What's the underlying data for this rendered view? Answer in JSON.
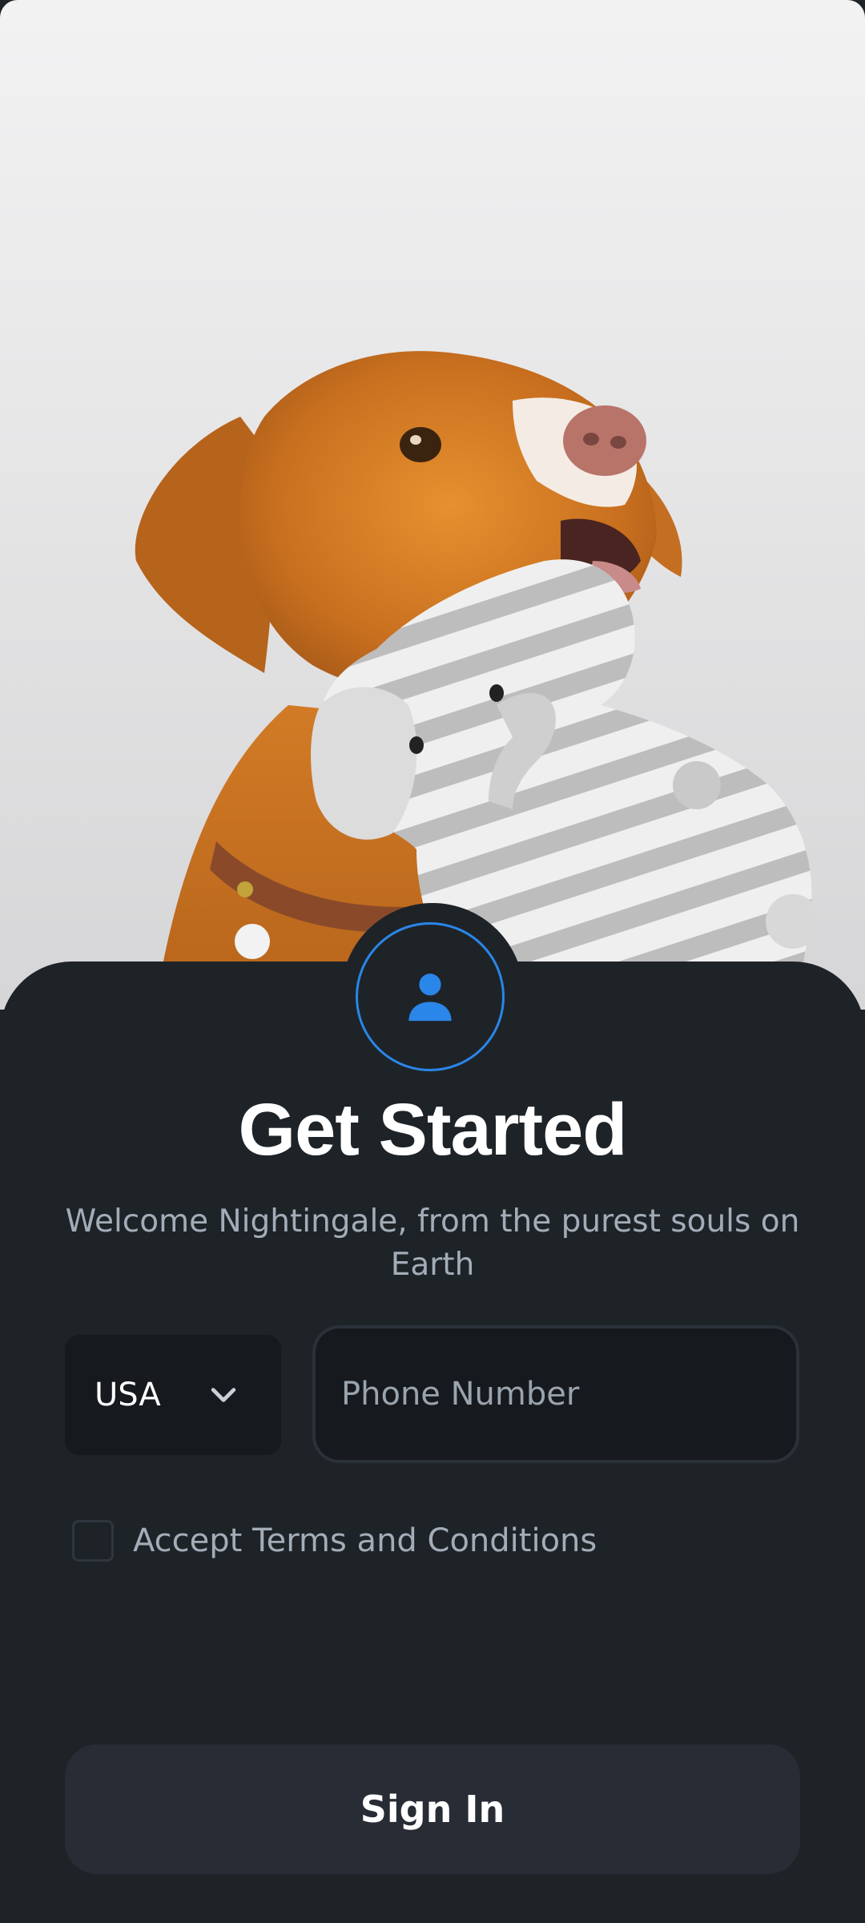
{
  "header": {
    "title": "Get Started",
    "subtitle": "Welcome Nightingale, from the purest souls on Earth"
  },
  "form": {
    "country": {
      "selected": "USA",
      "icon": "chevron-down-icon"
    },
    "phone": {
      "placeholder": "Phone Number",
      "value": ""
    },
    "terms": {
      "label": "Accept Terms and Conditions",
      "checked": false
    },
    "submit_label": "Sign In"
  },
  "avatar": {
    "icon": "user-icon"
  },
  "colors": {
    "background": "#1e2328",
    "accent": "#2a86e8",
    "text_primary": "#ffffff",
    "text_secondary": "#a3adb8",
    "input_bg": "#16191d",
    "button_bg": "#272c35"
  }
}
